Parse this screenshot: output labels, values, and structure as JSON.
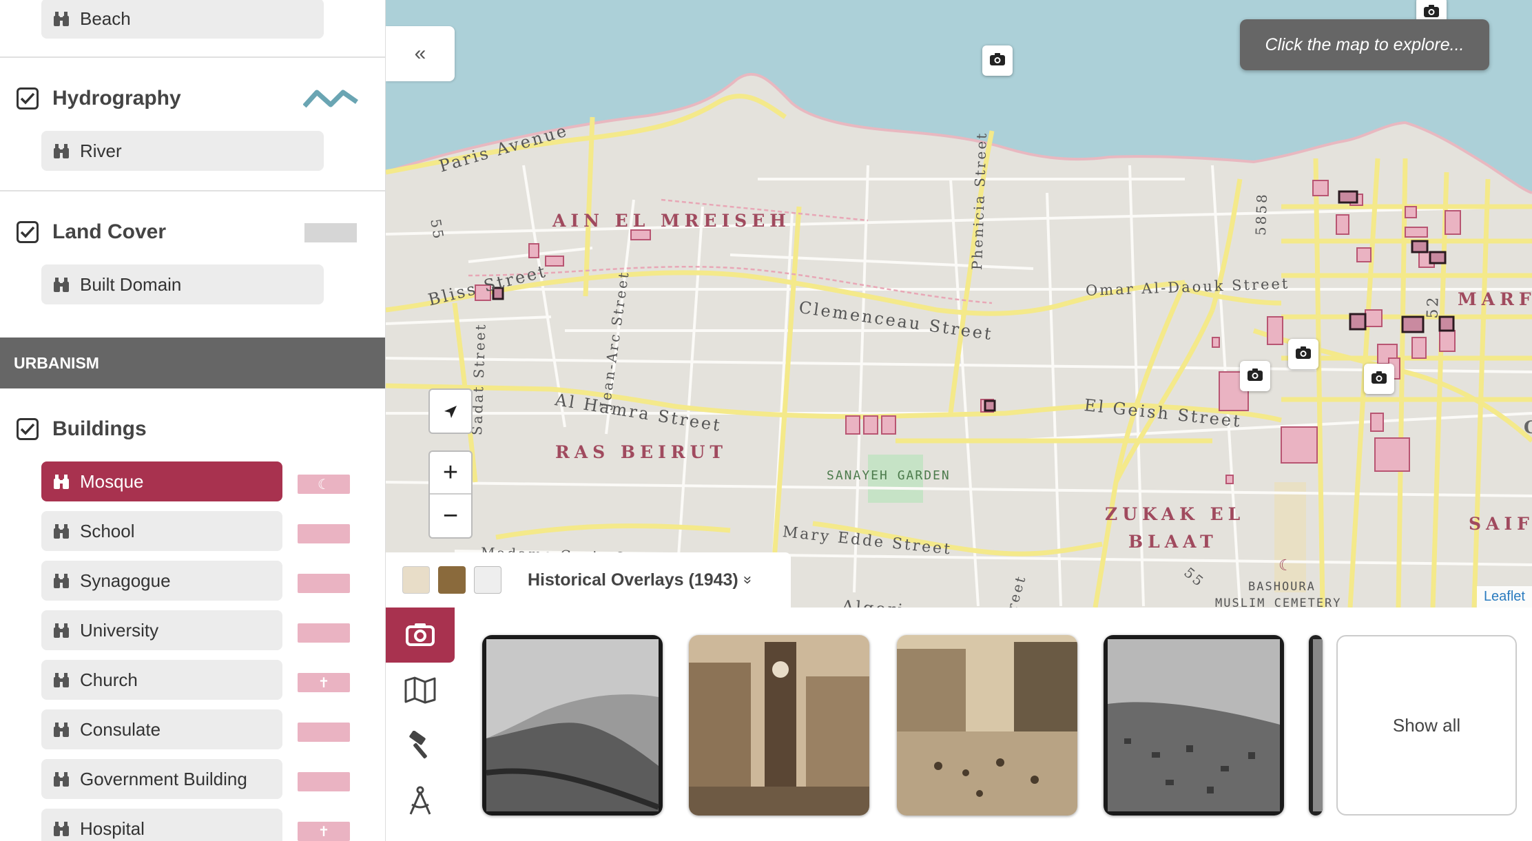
{
  "sidebar": {
    "top_item": {
      "label": "Beach"
    },
    "hydrography": {
      "title": "Hydrography",
      "checked": true,
      "items": [
        {
          "label": "River"
        }
      ]
    },
    "land_cover": {
      "title": "Land Cover",
      "checked": true,
      "items": [
        {
          "label": "Built Domain"
        }
      ]
    },
    "section": "URBANISM",
    "buildings": {
      "title": "Buildings",
      "checked": true,
      "items": [
        {
          "label": "Mosque",
          "active": true,
          "swatch_symbol": "☾"
        },
        {
          "label": "School",
          "swatch_symbol": ""
        },
        {
          "label": "Synagogue",
          "swatch_symbol": ""
        },
        {
          "label": "University",
          "swatch_symbol": ""
        },
        {
          "label": "Church",
          "swatch_symbol": "✝"
        },
        {
          "label": "Consulate",
          "swatch_symbol": ""
        },
        {
          "label": "Government Building",
          "swatch_symbol": ""
        },
        {
          "label": "Hospital",
          "swatch_symbol": "✝"
        }
      ]
    }
  },
  "colors": {
    "accent": "#a8324f",
    "swatch": "#eab3c2",
    "water": "#acd0d8",
    "land": "#e4e2dc",
    "road": "#f4e98a",
    "park": "#c6e3c6"
  },
  "map": {
    "collapse_label": "«",
    "tooltip": "Click the map to explore...",
    "attribution": "Leaflet",
    "overlays_label": "Historical Overlays (1943)",
    "overlays_chevron": "»",
    "streets": {
      "paris": "Paris Avenue",
      "bliss": "Bliss Street",
      "clemenceau": "Clemenceau Street",
      "omar": "Omar Al-Daouk Street",
      "hamra": "Al Hamra Street",
      "geish": "El Geish Street",
      "mary": "Mary Edde Street",
      "phenicia": "Phenicia Street",
      "jeanarc": "Jean-Arc Street",
      "sadat": "Sadat Street",
      "madame": "Madame Curie Street",
      "algeria": "Algeri",
      "n5858": "5858",
      "n52": "52",
      "n55a": "55",
      "n55b": "55",
      "reet": "reet"
    },
    "districts": {
      "ain": "AIN EL MREISEH",
      "ras": "RAS BEIRUT",
      "zukak1": "ZUKAK EL",
      "zukak2": "BLAAT",
      "marfa": "MARFA",
      "saif": "SAIF",
      "c": "C"
    },
    "places": {
      "sanayeh": "SANAYEH GARDEN",
      "bashoura1": "BASHOURA",
      "bashoura2": "MUSLIM CEMETERY"
    },
    "zoom_in": "+",
    "zoom_out": "−"
  },
  "gallery": {
    "show_all": "Show all",
    "tools": [
      "camera-tool",
      "map-tool",
      "hammer-tool",
      "compass-tool"
    ]
  }
}
